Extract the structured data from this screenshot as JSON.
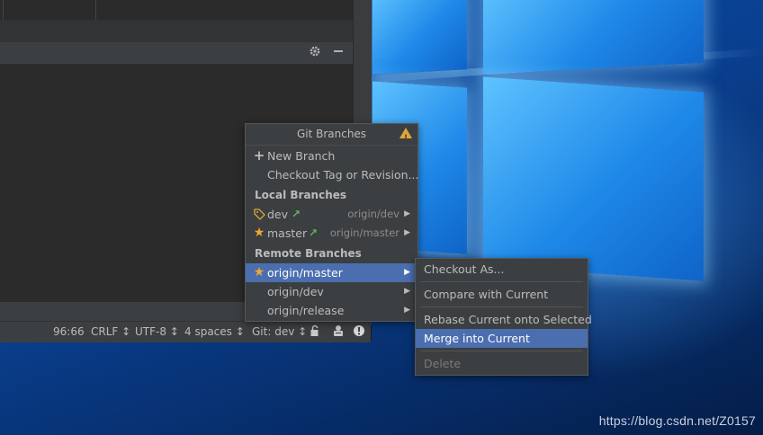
{
  "popup": {
    "title": "Git Branches",
    "actions": [
      {
        "label": "New Branch",
        "icon": "plus-icon"
      },
      {
        "label": "Checkout Tag or Revision..."
      }
    ],
    "local_header": "Local Branches",
    "local_branches": [
      {
        "name": "dev",
        "tracking": "origin/dev",
        "icon": "tag-icon"
      },
      {
        "name": "master",
        "tracking": "origin/master",
        "icon": "star-icon"
      }
    ],
    "remote_header": "Remote Branches",
    "remote_branches": [
      {
        "name": "origin/master",
        "icon": "star-icon"
      },
      {
        "name": "origin/dev"
      },
      {
        "name": "origin/release"
      }
    ]
  },
  "submenu": {
    "items": [
      {
        "label": "Checkout As..."
      },
      {
        "label": "Compare with Current"
      },
      {
        "label": "Rebase Current onto Selected"
      },
      {
        "label": "Merge into Current"
      },
      {
        "label": "Delete"
      }
    ]
  },
  "status_bar": {
    "position": "96:66",
    "line_sep": "CRLF ↕",
    "encoding": "UTF-8 ↕",
    "indent": "4 spaces ↕",
    "git": "Git: dev ↕"
  },
  "watermark": "https://blog.csdn.net/Z0157",
  "colors": {
    "selection": "#4b6eaf",
    "popup_bg": "#3c3f41",
    "ide_bg": "#2b2b2b",
    "star": "#f0a732",
    "outgoing_arrow": "#5fb45f",
    "warning": "#e0a53a"
  }
}
